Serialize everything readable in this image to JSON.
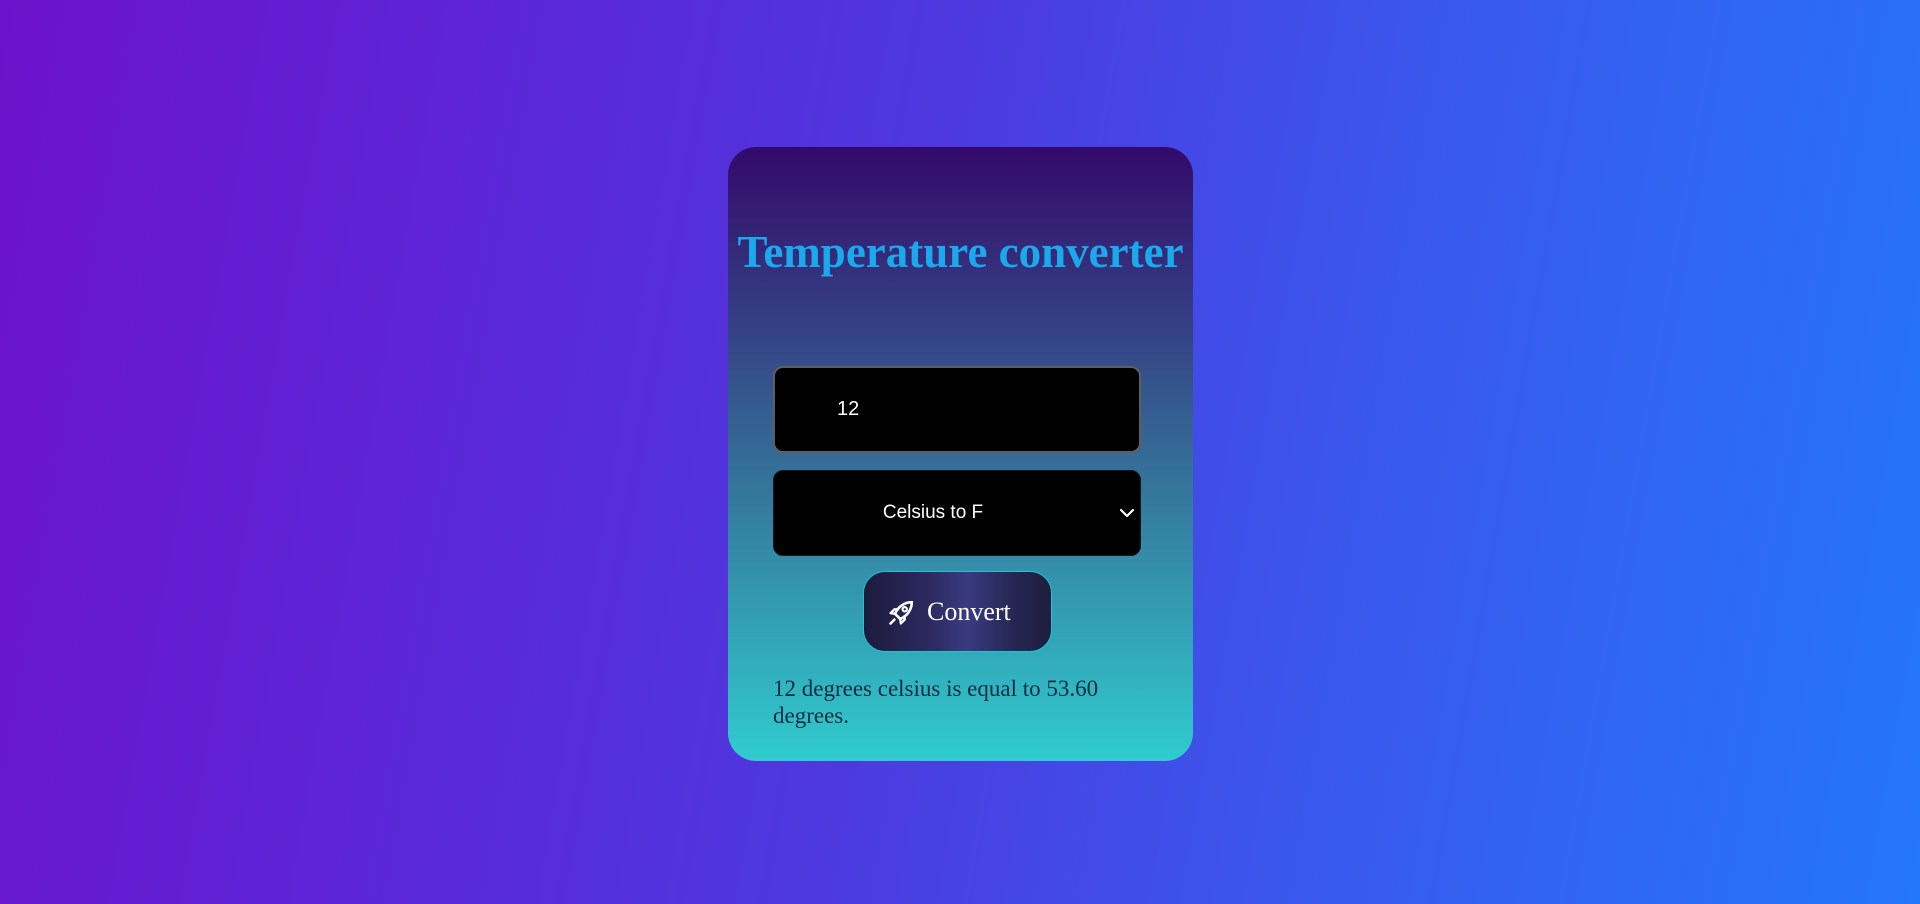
{
  "converter": {
    "title": "Temperature converter",
    "input_value": "12",
    "select_value": "Celsius to F",
    "convert_label": "Convert",
    "result_text": "12 degrees celsius is equal to 53.60 degrees."
  },
  "icons": {
    "button_icon": "rocket-icon",
    "select_icon": "chevron-down-icon"
  },
  "colors": {
    "background_start": "#6d12cc",
    "background_end": "#2476fb",
    "card_top": "#330a6a",
    "card_bottom": "#30cccf",
    "title": "#1aa9ec",
    "button_border": "#20c5d3",
    "result_text": "#0f2d40"
  }
}
